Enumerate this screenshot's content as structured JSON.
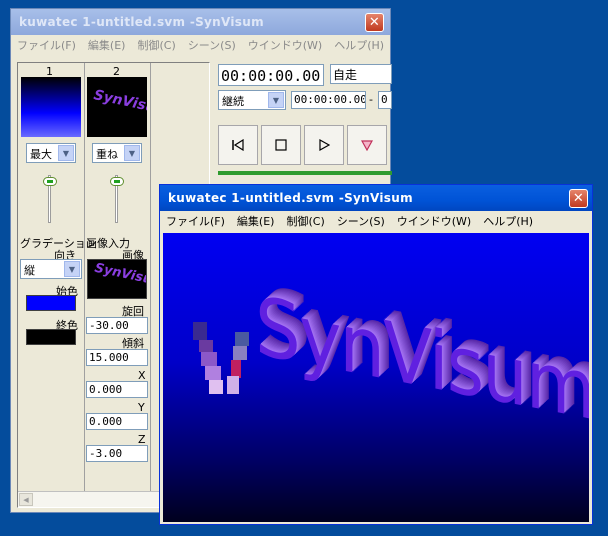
{
  "back_window": {
    "title": "kuwatec 1-untitled.svm -SynVisum",
    "menu": [
      "ファイル(F)",
      "編集(E)",
      "制御(C)",
      "シーン(S)",
      "ウインドウ(W)",
      "ヘルプ(H)"
    ],
    "layers": [
      {
        "number": "1",
        "blend": "最大",
        "type_label": "グラデーション",
        "orientation_label": "向き",
        "orientation": "縦",
        "start_color_label": "始色",
        "end_color_label": "終色",
        "start_color": "#0000ff",
        "end_color": "#000000"
      },
      {
        "number": "2",
        "blend": "重ね",
        "type_label": "画像入力",
        "image_label": "画像",
        "rotation_label": "旋回",
        "rotation": "-30.00",
        "tilt_label": "傾斜",
        "tilt": "15.000",
        "x_label": "X",
        "x": "0.000",
        "y_label": "Y",
        "y": "0.000",
        "z_label": "Z",
        "z": "-3.00"
      }
    ],
    "transport": {
      "timecode": "00:00:00.00",
      "mode": "自走",
      "loop_mode": "継続",
      "start_time": "00:00:00.00",
      "separator": "-",
      "end_time_partial": "0",
      "buttons": [
        "skip-start",
        "stop",
        "play",
        "record"
      ]
    }
  },
  "front_window": {
    "title": "kuwatec 1-untitled.svm -SynVisum",
    "menu": [
      "ファイル(F)",
      "編集(E)",
      "制御(C)",
      "シーン(S)",
      "ウインドウ(W)",
      "ヘルプ(H)"
    ],
    "preview_text": "SynVisum"
  },
  "colors": {
    "titlebar_active_start": "#0a5fe0",
    "titlebar_inactive": "#97b1e3",
    "desktop": "#044c9c"
  },
  "icons": {
    "close": "✕",
    "dropdown": "▼",
    "skip_start": "|◁",
    "stop": "□",
    "play": "▷",
    "record": "▽"
  }
}
